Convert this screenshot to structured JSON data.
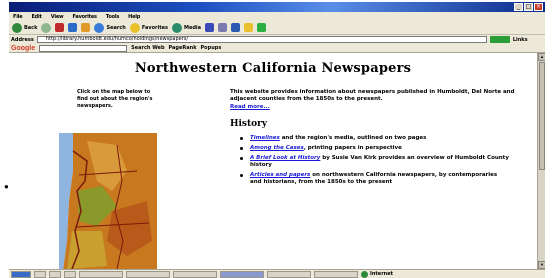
{
  "menu": [
    "File",
    "Edit",
    "View",
    "Favorites",
    "Tools",
    "Help"
  ],
  "toolbar": {
    "back_label": "Back",
    "search_label": "Search",
    "favorites_label": "Favorites",
    "media_label": "Media"
  },
  "address": {
    "label": "Address",
    "url": "http://library.humboldt.edu/humco/holdings/newspapers/",
    "links_label": "Links"
  },
  "google": {
    "logo": "Google",
    "search_web_label": "Search Web",
    "pagerank_label": "PageRank",
    "popups_label": "Popups"
  },
  "page": {
    "title": "Northwestern California Newspapers",
    "intro_left": "Click on the map below to find out about the region's newspapers.",
    "intro_right": "This website provides information about newspapers published in Humboldt, Del Norte and adjacent counties from the 1850s to the present.",
    "read_more": "Read more...",
    "history_heading": "History",
    "history_items": [
      {
        "link": "Timelines",
        "text": " and the region's media, outlined on two pages"
      },
      {
        "link": "Among the Cases",
        "text": ", printing papers in perspective"
      },
      {
        "link": "A Brief Look at History",
        "text": " by Susie Van Kirk provides an overview of Humboldt County history"
      },
      {
        "link": "Articles and papers",
        "text": " on northwestern California newspapers, by contemporaries and historians, from the 1850s to the present"
      }
    ]
  },
  "status": {
    "zone": "Internet"
  },
  "colors": {
    "link": "#1a1ad8",
    "titlebar": "#1c4fc0",
    "chrome": "#ece9d8"
  }
}
